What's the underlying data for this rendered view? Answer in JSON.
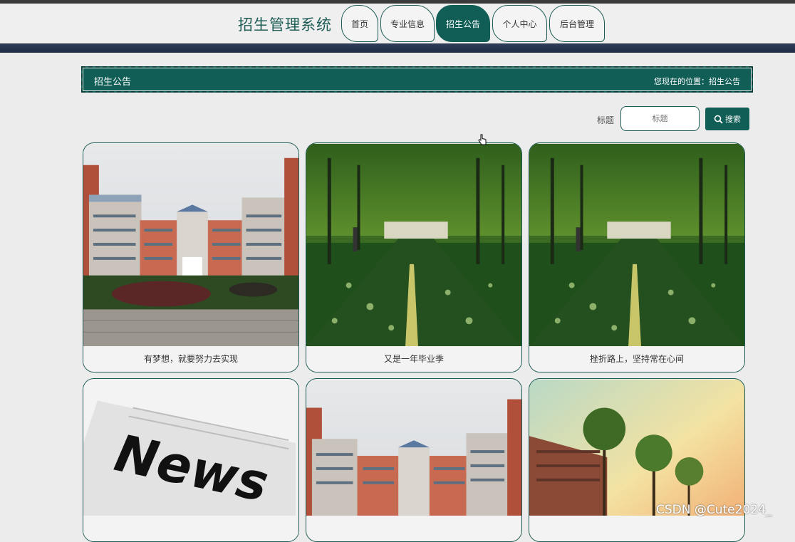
{
  "header": {
    "site_title": "招生管理系统",
    "nav_tabs": [
      {
        "label": "首页",
        "active": false
      },
      {
        "label": "专业信息",
        "active": false
      },
      {
        "label": "招生公告",
        "active": true
      },
      {
        "label": "个人中心",
        "active": false
      },
      {
        "label": "后台管理",
        "active": false
      }
    ]
  },
  "breadcrumb": {
    "title": "招生公告",
    "location": "您现在的位置：招生公告"
  },
  "search": {
    "label": "标题",
    "placeholder": "标题",
    "button_label": "搜索",
    "icon": "search-icon"
  },
  "cards": [
    {
      "caption": "有梦想，就要努力去实现",
      "image": "campus-building-photo"
    },
    {
      "caption": "又是一年毕业季",
      "image": "tree-lined-path-photo"
    },
    {
      "caption": "挫折路上，坚持常在心间",
      "image": "tree-lined-path-photo"
    },
    {
      "caption": "",
      "image": "news-newspaper-photo",
      "image_text": "News"
    },
    {
      "caption": "",
      "image": "campus-building-photo"
    },
    {
      "caption": "",
      "image": "sunset-campus-photo"
    }
  ],
  "watermark": "CSDN @Cute2024_",
  "colors": {
    "accent": "#115e57",
    "nav_band": "#2a3651",
    "background": "#ececec"
  }
}
